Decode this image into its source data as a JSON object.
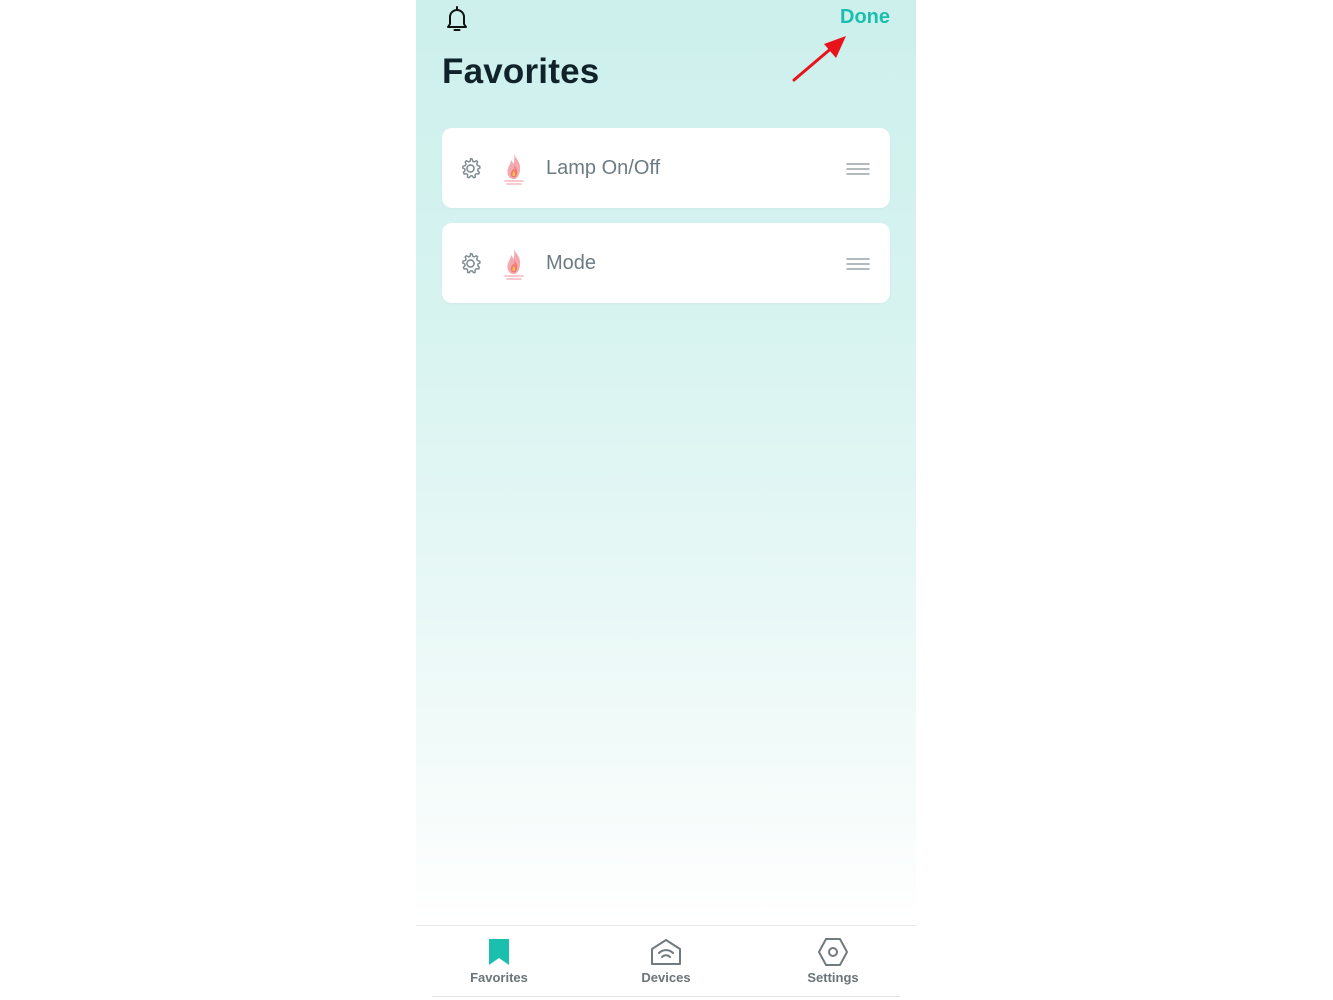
{
  "header": {
    "done_label": "Done",
    "title": "Favorites"
  },
  "favorites": [
    {
      "label": "Lamp On/Off",
      "icon": "gear-icon",
      "device_icon": "flame-device-icon"
    },
    {
      "label": "Mode",
      "icon": "gear-icon",
      "device_icon": "flame-device-icon"
    }
  ],
  "tabs": [
    {
      "label": "Favorites",
      "icon": "bookmark-icon",
      "active": true
    },
    {
      "label": "Devices",
      "icon": "home-wifi-icon",
      "active": false
    },
    {
      "label": "Settings",
      "icon": "hexagon-gear-icon",
      "active": false
    }
  ],
  "colors": {
    "accent": "#1bbfae",
    "annotation_arrow": "#e8141b",
    "title": "#10222a",
    "item_text": "#6d7b82"
  }
}
